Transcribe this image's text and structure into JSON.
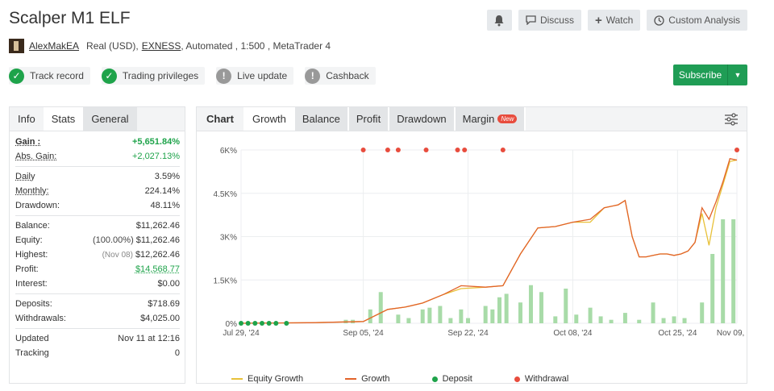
{
  "title": "Scalper M1 ELF",
  "header_actions": {
    "discuss": "Discuss",
    "watch": "Watch",
    "custom_analysis": "Custom Analysis"
  },
  "meta": {
    "author": "AlexMakEA",
    "account": "Real (USD),",
    "broker": "EXNESS",
    "details": ", Automated , 1:500 , MetaTrader 4"
  },
  "badges": [
    {
      "label": "Track record",
      "status": "ok"
    },
    {
      "label": "Trading privileges",
      "status": "ok"
    },
    {
      "label": "Live update",
      "status": "warn"
    },
    {
      "label": "Cashback",
      "status": "warn"
    }
  ],
  "subscribe": "Subscribe",
  "left_tabs": [
    "Info",
    "Stats",
    "General"
  ],
  "stats": {
    "gain_label": "Gain :",
    "gain": "+5,651.84%",
    "abs_gain_label": "Abs. Gain:",
    "abs_gain": "+2,027.13%",
    "daily_label": "Daily",
    "daily": "3.59%",
    "monthly_label": "Monthly:",
    "monthly": "224.14%",
    "drawdown_label": "Drawdown:",
    "drawdown": "48.11%",
    "balance_label": "Balance:",
    "balance": "$11,262.46",
    "equity_label": "Equity:",
    "equity_pct": "(100.00%)",
    "equity": "$11,262.46",
    "highest_label": "Highest:",
    "highest_date": "(Nov 08)",
    "highest": "$12,262.46",
    "profit_label": "Profit:",
    "profit": "$14,568.77",
    "interest_label": "Interest:",
    "interest": "$0.00",
    "deposits_label": "Deposits:",
    "deposits": "$718.69",
    "withdrawals_label": "Withdrawals:",
    "withdrawals": "$4,025.00",
    "updated_label": "Updated",
    "updated": "Nov 11 at 12:16",
    "tracking_label": "Tracking",
    "tracking": "0"
  },
  "chart_tabs": [
    "Chart",
    "Growth",
    "Balance",
    "Profit",
    "Drawdown",
    "Margin"
  ],
  "new_badge": "New",
  "colors": {
    "growth": "#e2632a",
    "equity_growth": "#e8c13a",
    "deposit": "#1ea34a",
    "withdrawal": "#e84c3d",
    "bars": "#a8dba8",
    "accent": "#1f9d55"
  },
  "chart_data": {
    "type": "line",
    "x_ticks": [
      "Jul 29, '24",
      "Sep 05, '24",
      "Sep 22, '24",
      "Oct 08, '24",
      "Oct 25, '24",
      "Nov 09, '24"
    ],
    "y_ticks": [
      "0%",
      "1.5K%",
      "3K%",
      "4.5K%",
      "6K%"
    ],
    "ylim": [
      0,
      6000
    ],
    "grid": true,
    "legend_position": "bottom",
    "legend": [
      "Equity Growth",
      "Growth",
      "Deposit",
      "Withdrawal"
    ],
    "series": [
      {
        "name": "Growth",
        "x": [
          0,
          10,
          20,
          35,
          37,
          42,
          47,
          52,
          58,
          63,
          70,
          75,
          80,
          85,
          90,
          95,
          100,
          104,
          108,
          110,
          112,
          114,
          116,
          118,
          120,
          122,
          124,
          126,
          128,
          130,
          132,
          134,
          136,
          138,
          140,
          142
        ],
        "y": [
          0,
          10,
          20,
          60,
          180,
          480,
          560,
          700,
          1000,
          1300,
          1250,
          1300,
          2400,
          3300,
          3350,
          3500,
          3600,
          4000,
          4100,
          4250,
          3000,
          2300,
          2300,
          2350,
          2400,
          2400,
          2350,
          2400,
          2500,
          2800,
          4000,
          3600,
          4200,
          4900,
          5700,
          5650
        ]
      },
      {
        "name": "Equity Growth",
        "x": [
          0,
          10,
          20,
          35,
          37,
          42,
          47,
          52,
          58,
          63,
          70,
          75,
          80,
          85,
          90,
          95,
          100,
          104,
          108,
          110,
          112,
          114,
          116,
          118,
          120,
          122,
          124,
          126,
          128,
          130,
          132,
          134,
          136,
          138,
          140,
          142
        ],
        "y": [
          0,
          10,
          20,
          60,
          180,
          480,
          560,
          700,
          1000,
          1200,
          1250,
          1300,
          2400,
          3300,
          3350,
          3500,
          3500,
          4000,
          4100,
          4250,
          3000,
          2300,
          2300,
          2350,
          2400,
          2400,
          2350,
          2400,
          2500,
          2800,
          3800,
          2700,
          4000,
          4800,
          5600,
          5650
        ]
      }
    ],
    "deposits_x": [
      0,
      2,
      4,
      6,
      8,
      10,
      13
    ],
    "withdrawals_x": [
      35,
      42,
      45,
      53,
      62,
      64,
      75,
      142
    ],
    "bars_x": [
      30,
      32,
      37,
      40,
      45,
      48,
      52,
      54,
      57,
      60,
      63,
      65,
      70,
      72,
      74,
      76,
      80,
      83,
      86,
      90,
      93,
      96,
      100,
      103,
      106,
      110,
      114,
      118,
      121,
      124,
      127,
      132,
      135,
      138,
      141
    ],
    "bars_pct": [
      2,
      2,
      8,
      18,
      5,
      3,
      8,
      9,
      10,
      3,
      8,
      3,
      10,
      8,
      15,
      17,
      12,
      22,
      18,
      4,
      20,
      5,
      9,
      4,
      2,
      6,
      2,
      12,
      3,
      4,
      3,
      12,
      40,
      60,
      60
    ]
  }
}
